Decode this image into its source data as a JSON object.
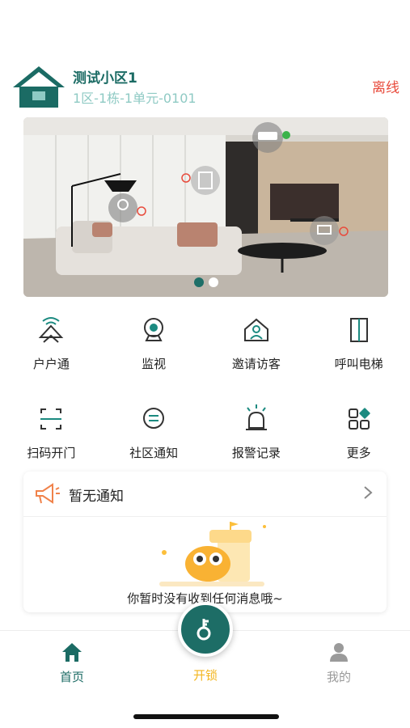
{
  "header": {
    "community_name": "测试小区1",
    "unit_address": "1区-1栋-1单元-0101",
    "status": "离线",
    "logo_icon": "house-icon"
  },
  "banner": {
    "slide_count": 2,
    "active_slide": 1,
    "device_icons": [
      "air-conditioner-icon",
      "lamp-icon",
      "curtain-icon",
      "tv-box-icon"
    ]
  },
  "functions": [
    {
      "label": "户户通",
      "icon": "intercom-icon"
    },
    {
      "label": "监视",
      "icon": "camera-icon"
    },
    {
      "label": "邀请访客",
      "icon": "invite-visitor-icon"
    },
    {
      "label": "呼叫电梯",
      "icon": "elevator-icon"
    },
    {
      "label": "扫码开门",
      "icon": "scan-icon"
    },
    {
      "label": "社区通知",
      "icon": "notice-icon"
    },
    {
      "label": "报警记录",
      "icon": "alarm-icon"
    },
    {
      "label": "更多",
      "icon": "more-icon"
    }
  ],
  "notice": {
    "title": "暂无通知",
    "empty_text": "你暂时没有收到任何消息哦~"
  },
  "tabbar": {
    "home": "首页",
    "unlock": "开锁",
    "mine": "我的"
  },
  "colors": {
    "primary": "#1b6b64",
    "accent": "#f3b61f",
    "offline": "#e84b3c",
    "unit_text": "#8fcac4"
  }
}
